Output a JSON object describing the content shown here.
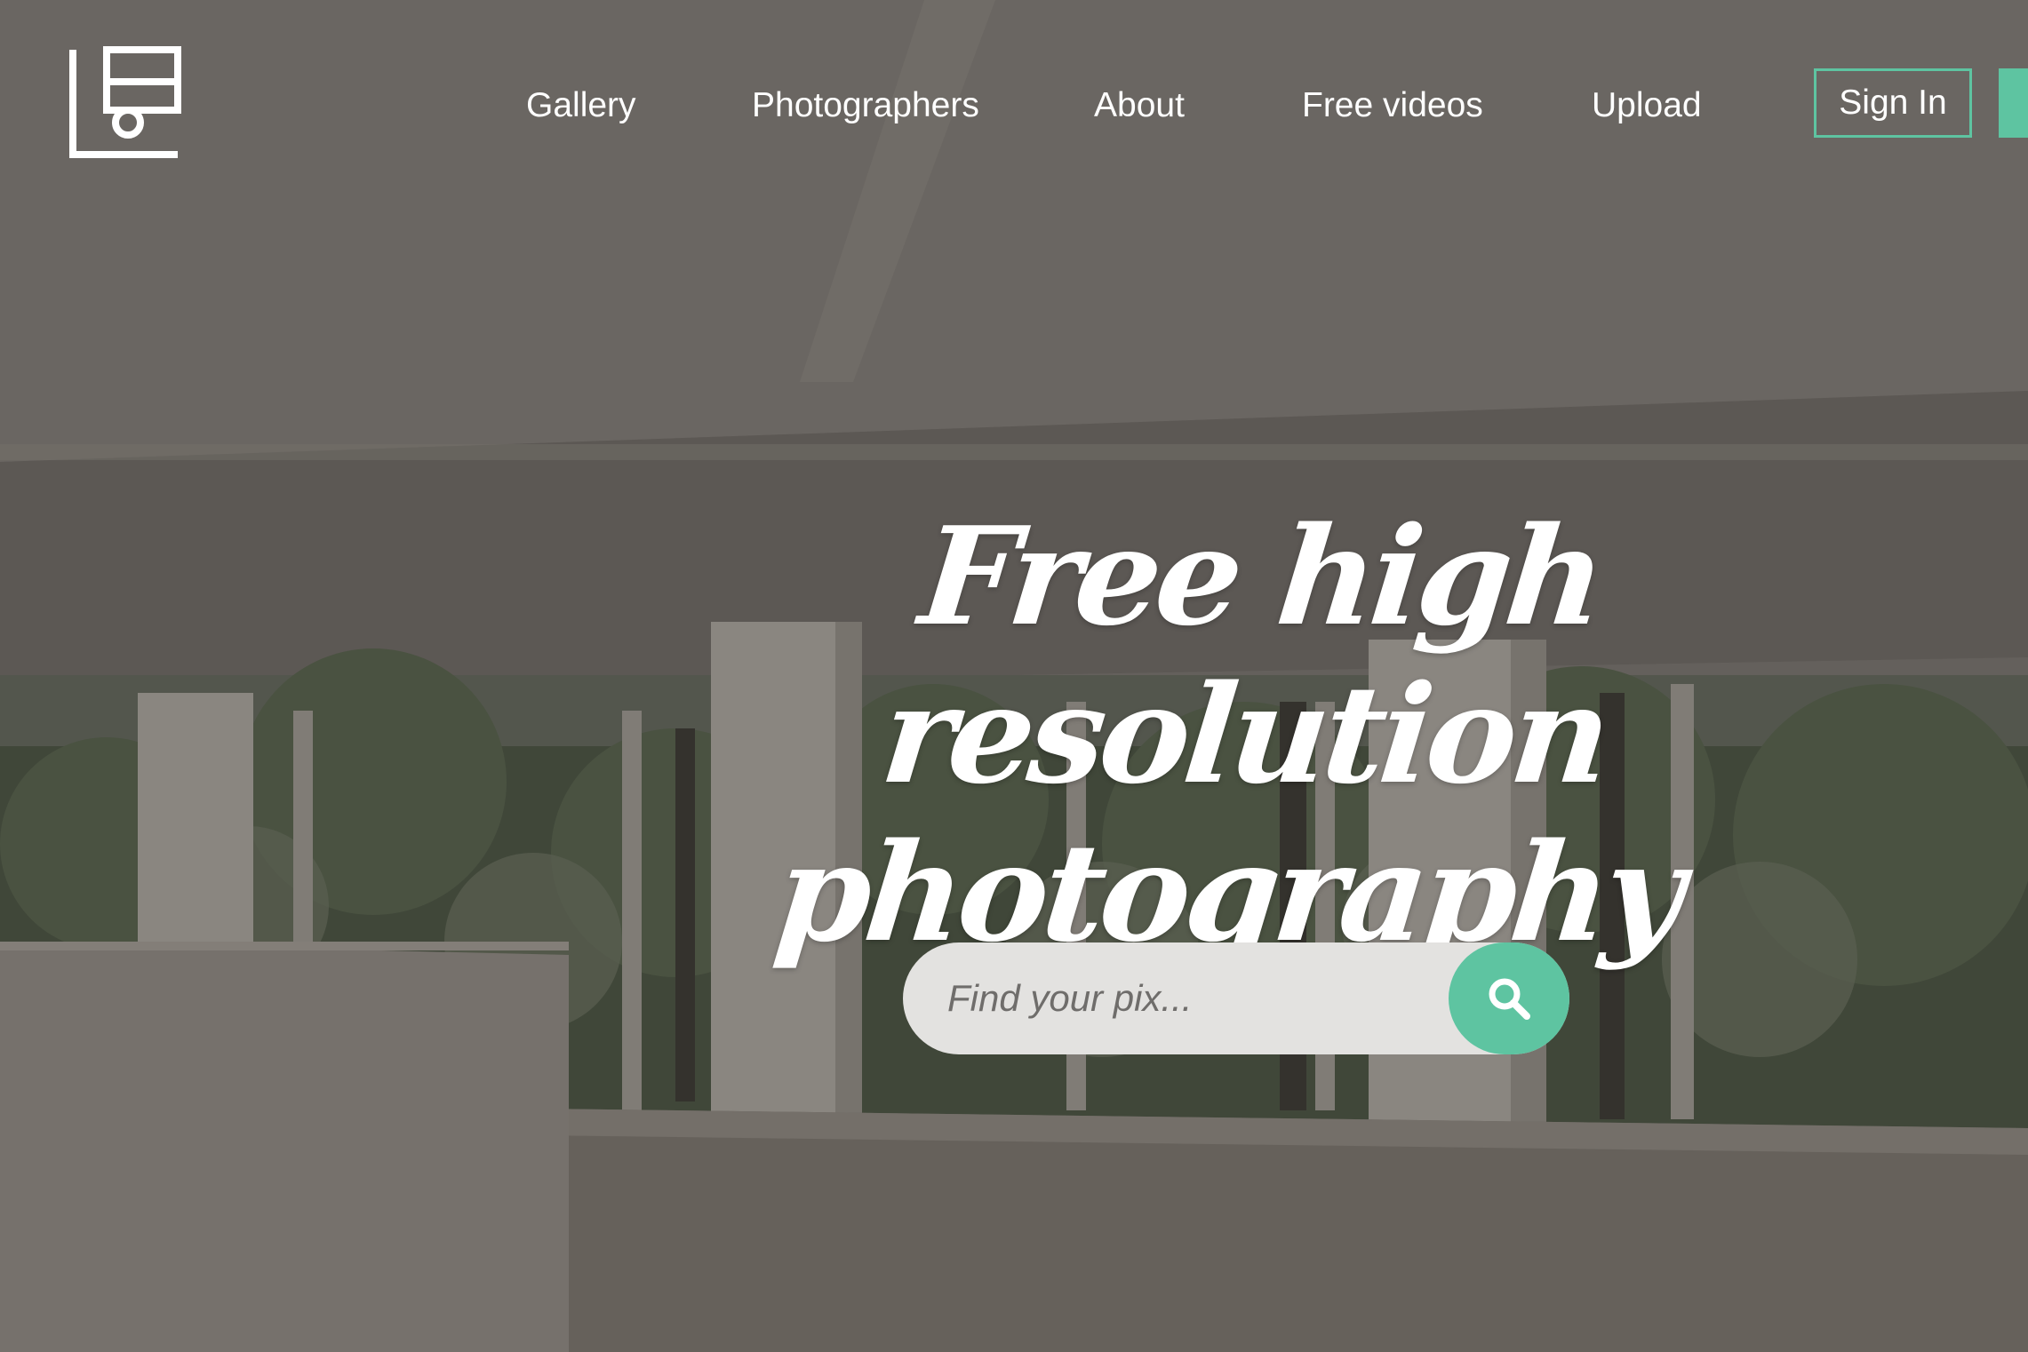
{
  "header": {
    "logo_icon": "camera-frame-logo-icon",
    "nav": [
      {
        "label": "Gallery"
      },
      {
        "label": "Photographers"
      },
      {
        "label": "About"
      },
      {
        "label": "Free videos"
      },
      {
        "label": "Upload"
      }
    ],
    "signin_label": "Sign In"
  },
  "hero": {
    "title_line1": "Free high resolution",
    "title_line2": "photography"
  },
  "search": {
    "placeholder": "Find your pix...",
    "button_icon": "search-icon"
  },
  "colors": {
    "accent": "#5ec4a1",
    "overlay": "#2c2622",
    "search_bg": "#e3e2e0"
  }
}
